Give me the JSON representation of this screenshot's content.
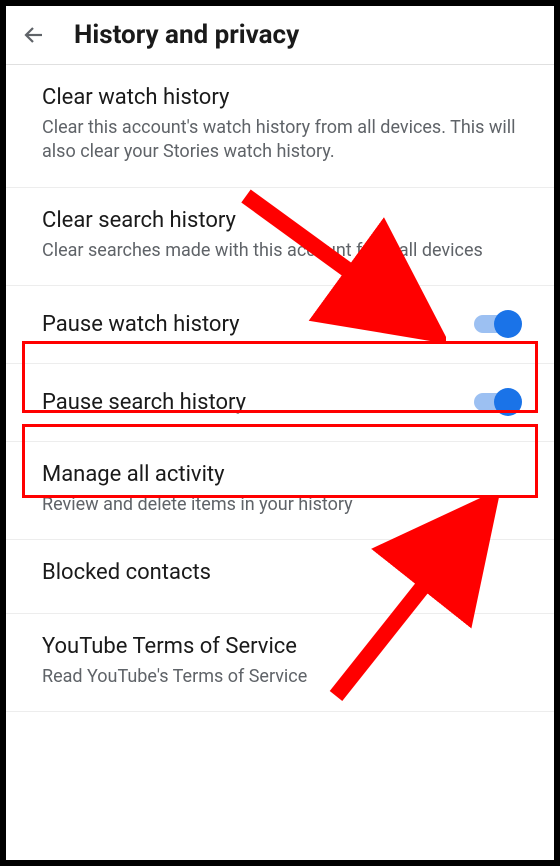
{
  "header": {
    "title": "History and privacy"
  },
  "items": [
    {
      "title": "Clear watch history",
      "subtitle": "Clear this account's watch history from all devices. This will also clear your Stories watch history."
    },
    {
      "title": "Clear search history",
      "subtitle": "Clear searches made with this account from all devices"
    },
    {
      "title": "Pause watch history",
      "toggle": true,
      "on": true
    },
    {
      "title": "Pause search history",
      "toggle": true,
      "on": true
    },
    {
      "title": "Manage all activity",
      "subtitle": "Review and delete items in your history"
    },
    {
      "title": "Blocked contacts"
    },
    {
      "title": "YouTube Terms of Service",
      "subtitle": "Read YouTube's Terms of Service"
    }
  ],
  "annotations": {
    "highlight_color": "#ff0000",
    "arrow_color": "#ff0000"
  }
}
